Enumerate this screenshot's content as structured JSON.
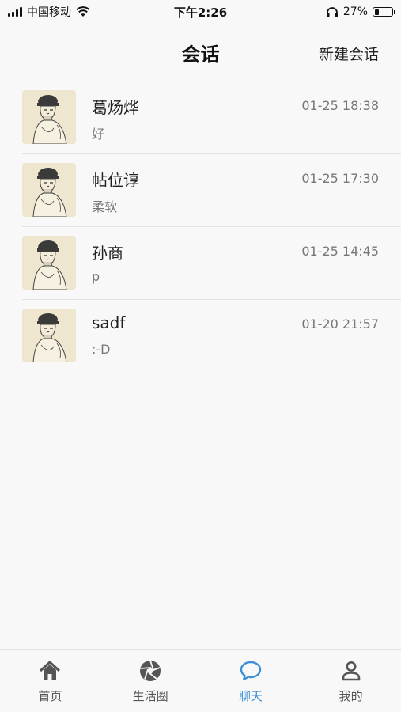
{
  "status_bar": {
    "carrier": "中国移动",
    "time": "下午2:26",
    "battery_percent": "27%",
    "battery_level": 0.27
  },
  "header": {
    "title": "会话",
    "new_conversation_label": "新建会话"
  },
  "conversations": [
    {
      "name": "葛炀烨",
      "preview": "好",
      "time": "01-25 18:38"
    },
    {
      "name": "帖位谆",
      "preview": "柔软",
      "time": "01-25 17:30"
    },
    {
      "name": "孙商",
      "preview": "p",
      "time": "01-25 14:45"
    },
    {
      "name": "sadf",
      "preview": ":-D",
      "time": "01-20 21:57"
    }
  ],
  "tabs": [
    {
      "label": "首页",
      "icon": "home-icon"
    },
    {
      "label": "生活圈",
      "icon": "aperture-icon"
    },
    {
      "label": "聊天",
      "icon": "chat-bubble-icon",
      "active": true
    },
    {
      "label": "我的",
      "icon": "person-icon"
    }
  ],
  "colors": {
    "accent": "#3d8fd6",
    "background": "#f8f8f8",
    "avatar_background": "#efe6cf"
  }
}
